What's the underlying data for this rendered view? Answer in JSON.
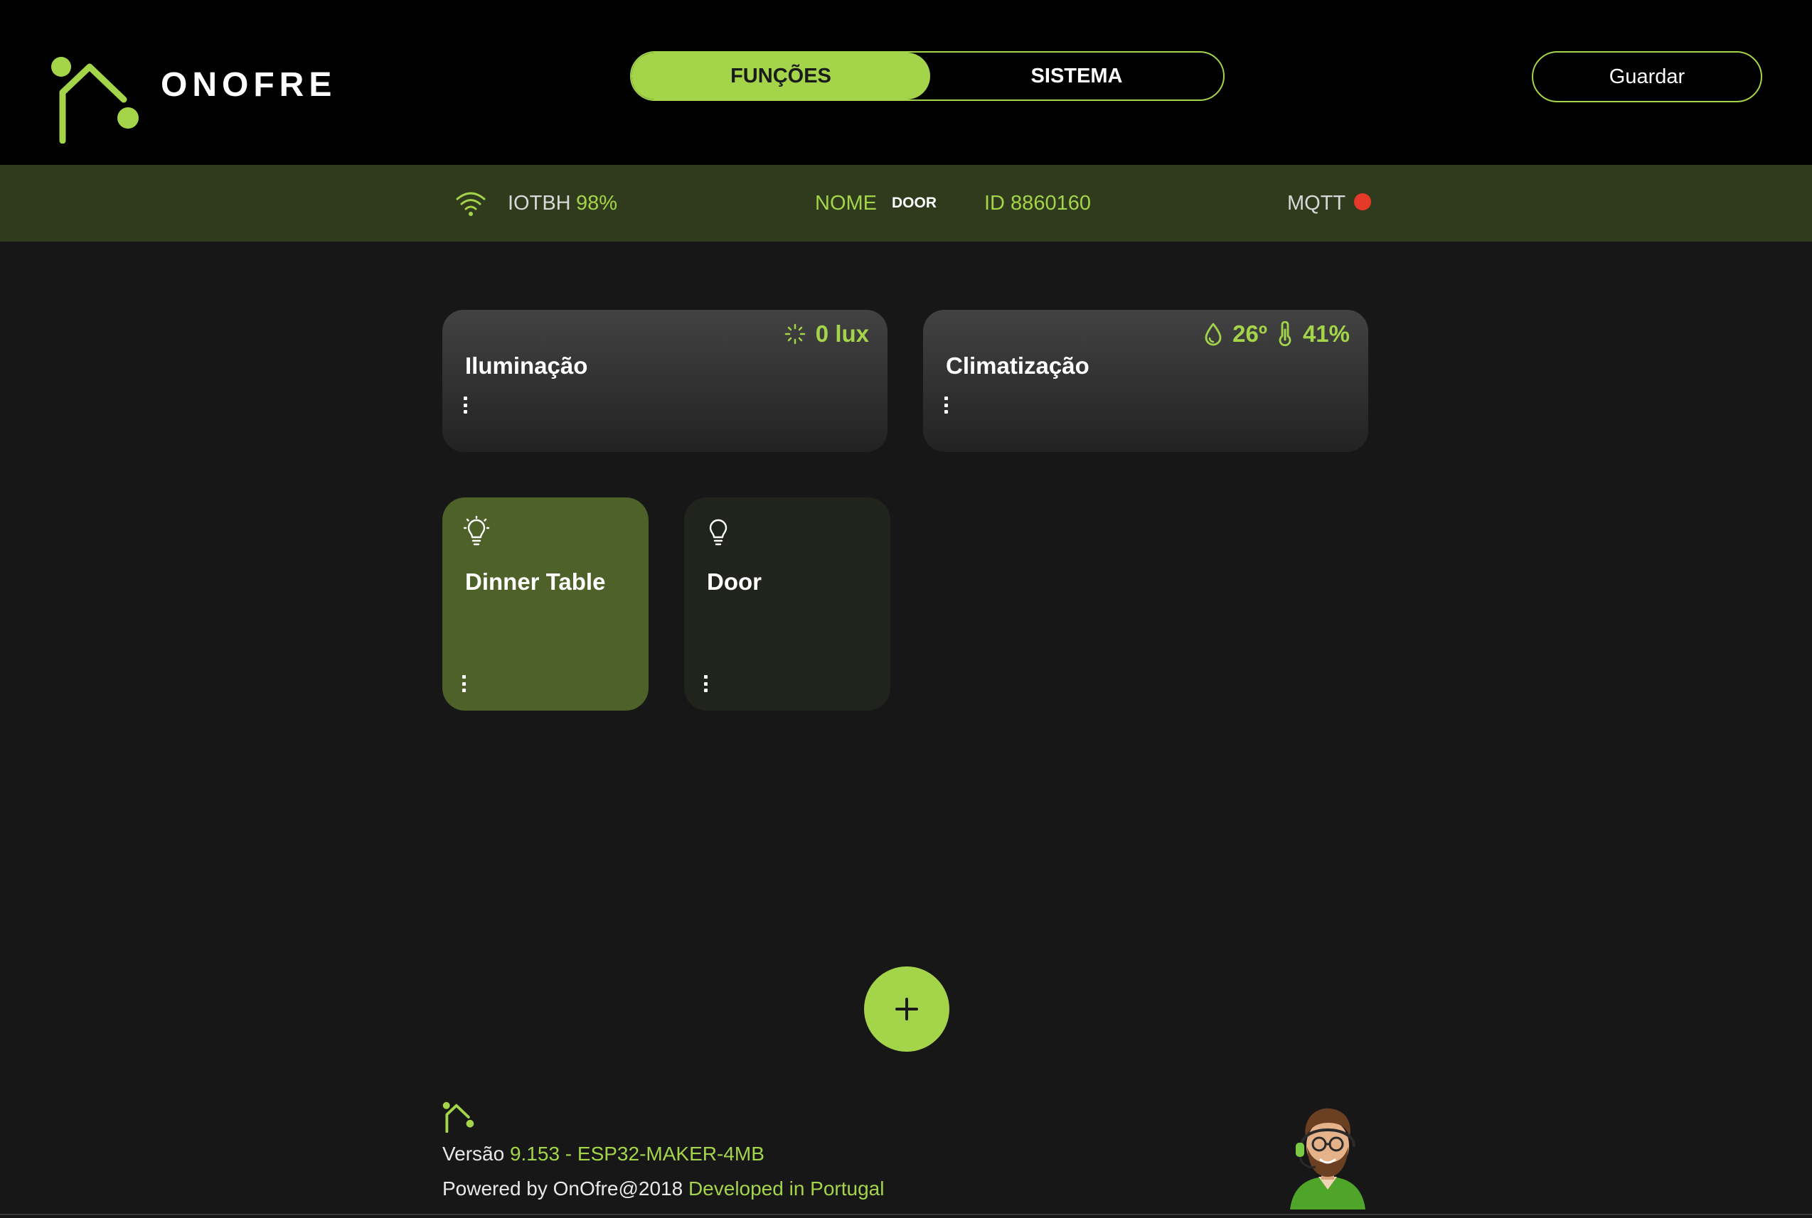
{
  "header": {
    "logo_text": "ONOFRE",
    "tabs": [
      {
        "label": "FUNÇÕES",
        "active": true
      },
      {
        "label": "SISTEMA",
        "active": false
      }
    ],
    "save_label": "Guardar"
  },
  "status": {
    "ssid": "IOTBH",
    "signal": "98%",
    "name_label": "NOME",
    "name_value": "DOOR",
    "id": "ID 8860160",
    "mqtt_label": "MQTT",
    "mqtt_status_color": "#e53a2a"
  },
  "groups": [
    {
      "title": "Iluminação",
      "metric": "0 lux",
      "icon": "sun-icon"
    },
    {
      "title": "Climatização",
      "metric_1": "26º",
      "metric_2": "41%",
      "icons": [
        "drop-icon",
        "thermometer-icon"
      ]
    }
  ],
  "devices": [
    {
      "name": "Dinner Table",
      "state": "on",
      "icon": "bulb-on-icon"
    },
    {
      "name": "Door",
      "state": "off",
      "icon": "bulb-off-icon"
    }
  ],
  "add_button": "+",
  "footer": {
    "version_label": "Versão",
    "version_value": "9.153 - ESP32-MAKER-4MB",
    "powered_label": "Powered by OnOfre@2018",
    "developed_label": "Developed in Portugal"
  },
  "colors": {
    "accent": "#a4d449",
    "header_bg": "#000000",
    "status_bg": "#2f3b1c",
    "page_bg": "#171717",
    "device_on_bg": "#4e6128",
    "device_off_bg": "#21241d"
  }
}
